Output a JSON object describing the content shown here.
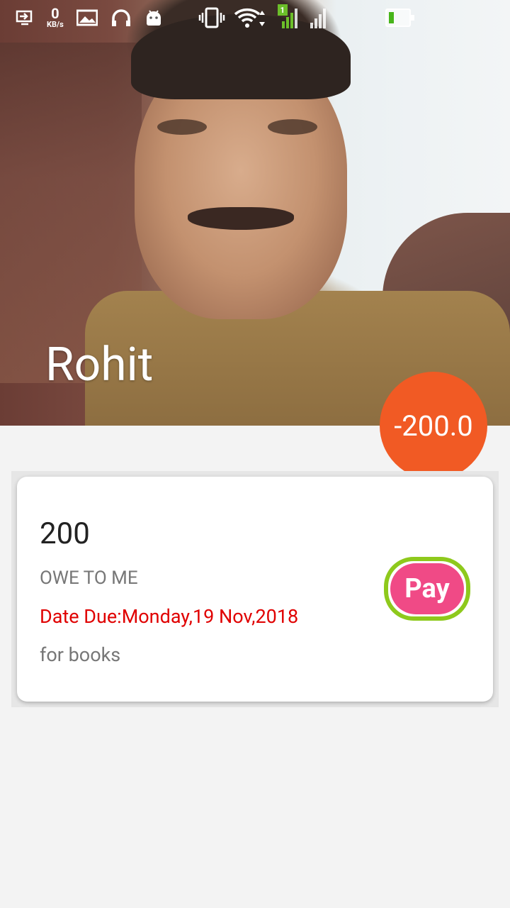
{
  "status_bar": {
    "net_speed_value": "0",
    "net_speed_unit": "KB/s",
    "sim1_badge": "1",
    "icons": [
      "screen-cast-icon",
      "image-icon",
      "headset-icon",
      "android-icon",
      "vibrate-icon",
      "wifi-icon",
      "signal-sim1-icon",
      "signal-sim2-icon",
      "battery-icon"
    ]
  },
  "profile": {
    "name": "Rohit",
    "balance": "-200.0",
    "balance_color": "#f15a24"
  },
  "transaction": {
    "amount": "200",
    "type": "OWE TO ME",
    "due_date": "Date Due:Monday,19 Nov,2018",
    "note": "for books",
    "pay_label": "Pay",
    "pay_color": "#f04a86",
    "pay_border_color": "#8ec91c",
    "due_color": "#e00000"
  }
}
